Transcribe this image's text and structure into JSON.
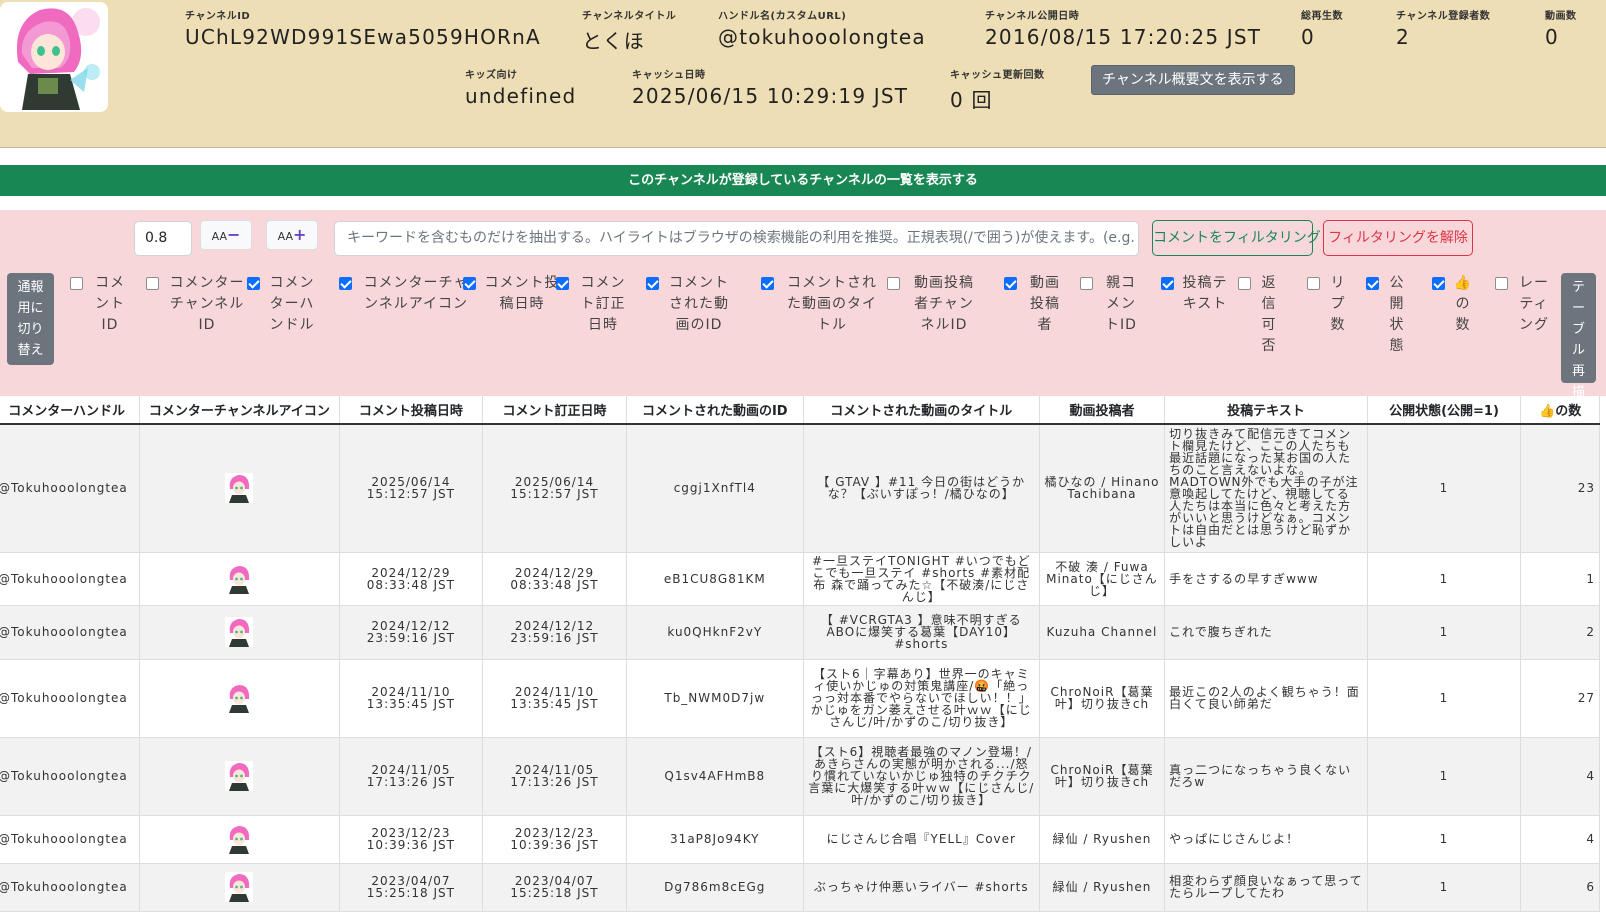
{
  "header": {
    "channel_id": {
      "label": "チャンネルID",
      "value": "UChL92WD991SEwa5059HORnA"
    },
    "channel_title": {
      "label": "チャンネルタイトル",
      "value": "とくほ"
    },
    "handle": {
      "label": "ハンドル名(カスタムURL)",
      "value": "@tokuhooolongtea"
    },
    "published": {
      "label": "チャンネル公開日時",
      "value": "2016/08/15 17:20:25 JST"
    },
    "total_views": {
      "label": "総再生数",
      "value": "0"
    },
    "subscribers": {
      "label": "チャンネル登録者数",
      "value": "2"
    },
    "videos": {
      "label": "動画数",
      "value": "0"
    },
    "kids": {
      "label": "キッズ向け",
      "value": "undefined"
    },
    "cache_date": {
      "label": "キャッシュ日時",
      "value": "2025/06/15 10:29:19 JST"
    },
    "cache_updates": {
      "label": "キャッシュ更新回数",
      "value": "0 回"
    },
    "about_button": "チャンネル概要文を表示する"
  },
  "subscriptions_bar": "このチャンネルが登録しているチャンネルの一覧を表示する",
  "toolbar": {
    "font_scale": "0.8",
    "font_down_label": "AA",
    "font_down_symbol": "−",
    "font_up_label": "AA",
    "font_up_symbol": "+",
    "keyword_placeholder": "キーワードを含むものだけを抽出する。ハイライトはブラウザの検索機能の利用を推奨。正規表現(/で囲う)が使えます。(e.g. /(B",
    "filter_button": "コメントをフィルタリング",
    "clear_button": "フィルタリングを解除",
    "report_toggle": "通報用に切り替え",
    "redraw_button": "テーブル再描画",
    "columns": [
      {
        "label": "コメントID",
        "checked": false
      },
      {
        "label": "コメンターチャンネルID",
        "checked": false
      },
      {
        "label": "コメンターハンドル",
        "checked": true
      },
      {
        "label": "コメンターチャンネルアイコン",
        "checked": true
      },
      {
        "label": "コメント投稿日時",
        "checked": true
      },
      {
        "label": "コメント訂正日時",
        "checked": true
      },
      {
        "label": "コメントされた動画のID",
        "checked": true
      },
      {
        "label": "コメントされた動画のタイトル",
        "checked": true
      },
      {
        "label": "動画投稿者チャンネルID",
        "checked": false
      },
      {
        "label": "動画投稿者",
        "checked": true
      },
      {
        "label": "親コメントID",
        "checked": false
      },
      {
        "label": "投稿テキスト",
        "checked": true
      },
      {
        "label": "返信可否",
        "checked": false
      },
      {
        "label": "リプ数",
        "checked": false
      },
      {
        "label": "公開状態",
        "checked": true
      },
      {
        "label": "👍の数",
        "checked": true
      },
      {
        "label": "レーティング",
        "checked": false
      }
    ]
  },
  "table": {
    "headers": [
      "コメンターハンドル",
      "コメンターチャンネルアイコン",
      "コメント投稿日時",
      "コメント訂正日時",
      "コメントされた動画のID",
      "コメントされた動画のタイトル",
      "動画投稿者",
      "投稿テキスト",
      "公開状態(公開=1)",
      "👍の数"
    ],
    "rows": [
      {
        "handle": "@Tokuhooolongtea",
        "posted": "2025/06/14 15:12:57 JST",
        "edited": "2025/06/14 15:12:57 JST",
        "video_id": "cggj1XnfTl4",
        "video_title": "【 GTAV 】#11 今日の街はどうかな？【ぶいすぽっ！/橘ひなの】",
        "uploader": "橘ひなの / Hinano Tachibana",
        "text": "切り抜きみて配信元きてコメント欄見たけど、ここの人たちも最近話題になった某お国の人たちのこと言えないよな。MADTOWN外でも大手の子が注意喚起してたけど、視聴してる人たちは本当に色々と考えた方がいいと思うけどなぁ。コメントは自由だとは思うけど恥ずかしいよ",
        "public": "1",
        "likes": "23"
      },
      {
        "handle": "@Tokuhooolongtea",
        "posted": "2024/12/29 08:33:48 JST",
        "edited": "2024/12/29 08:33:48 JST",
        "video_id": "eB1CU8G81KM",
        "video_title": "#一旦ステイTONIGHT #いつでもどこでも一旦ステイ #shorts #素材配布 森で踊ってみた☆【不破湊/にじさんじ】",
        "uploader": "不破 湊 / Fuwa Minato【にじさんじ】",
        "text": "手をさするの早すぎwww",
        "public": "1",
        "likes": "1"
      },
      {
        "handle": "@Tokuhooolongtea",
        "posted": "2024/12/12 23:59:16 JST",
        "edited": "2024/12/12 23:59:16 JST",
        "video_id": "ku0QHknF2vY",
        "video_title": "【 #VCRGTA3 】意味不明すぎるABOに爆笑する葛葉【DAY10】 #shorts",
        "uploader": "Kuzuha Channel",
        "text": "これで腹ちぎれた",
        "public": "1",
        "likes": "2"
      },
      {
        "handle": "@Tokuhooolongtea",
        "posted": "2024/11/10 13:35:45 JST",
        "edited": "2024/11/10 13:35:45 JST",
        "video_id": "Tb_NWM0D7jw",
        "video_title": "【スト6｜字幕あり】世界一のキャミィ使いかじゅの対策鬼講座/🤬「絶っっっ対本番でやらないでほしい！！」かじゅをガン萎えさせる叶ｗｗ【にじさんじ/叶/かずのこ/切り抜き】",
        "uploader": "ChroNoiR【葛葉叶】切り抜きch",
        "text": "最近この2人のよく観ちゃう！面白くて良い師弟だ",
        "public": "1",
        "likes": "27"
      },
      {
        "handle": "@Tokuhooolongtea",
        "posted": "2024/11/05 17:13:26 JST",
        "edited": "2024/11/05 17:13:26 JST",
        "video_id": "Q1sv4AFHmB8",
        "video_title": "【スト6】視聴者最強のマノン登場！/あきらさんの実態が明かされる.../怒り慣れていないかじゅ独特のチクチク言葉に大爆笑する叶ｗｗ【にじさんじ/叶/かずのこ/切り抜き】",
        "uploader": "ChroNoiR【葛葉叶】切り抜きch",
        "text": "真っ二つになっちゃう良くないだろw",
        "public": "1",
        "likes": "4"
      },
      {
        "handle": "@Tokuhooolongtea",
        "posted": "2023/12/23 10:39:36 JST",
        "edited": "2023/12/23 10:39:36 JST",
        "video_id": "31aP8Jo94KY",
        "video_title": "にじさんじ合唱『YELL』Cover",
        "uploader": "緑仙 / Ryushen",
        "text": "やっぱにじさんじよ！",
        "public": "1",
        "likes": "4"
      },
      {
        "handle": "@Tokuhooolongtea",
        "posted": "2023/04/07 15:25:18 JST",
        "edited": "2023/04/07 15:25:18 JST",
        "video_id": "Dg786m8cEGg",
        "video_title": "ぶっちゃけ仲悪いライバー #shorts",
        "uploader": "緑仙 / Ryushen",
        "text": "相変わらず顔良いなぁって思ってたらループしてたわ",
        "public": "1",
        "likes": "6"
      }
    ]
  }
}
